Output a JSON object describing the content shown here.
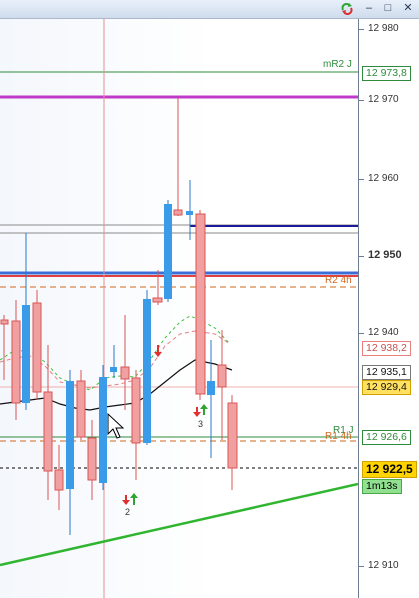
{
  "titlebar": {
    "minimize_glyph": "–",
    "maximize_glyph": "□",
    "close_glyph": "✕",
    "refresh_icon": "refresh-icon"
  },
  "y_axis": {
    "ticks": [
      "12 980",
      "12 970",
      "12 960",
      "12 950",
      "12 940",
      "12 930",
      "12 920",
      "12 910"
    ],
    "major_tick": "12 950"
  },
  "levels": {
    "mr2": {
      "name": "mR2 J",
      "value": "12 973,8",
      "color": "#2e8b3c"
    },
    "r2": {
      "name": "R2 4h",
      "color": "#d2691e"
    },
    "r1j": {
      "name": "R1 J",
      "color": "#2e8b3c"
    },
    "r1_4h": {
      "name": "R1 4h",
      "color": "#d2691e"
    }
  },
  "price_tags": {
    "ma_red": "12 938,2",
    "ma_black": "12 935,1",
    "r1j_value": "12 929,4",
    "r1_4h_value": "12 926,6",
    "last": "12 922,5",
    "timer": "1m13s"
  },
  "markers": {
    "signal_2": "2",
    "signal_3": "3"
  },
  "colors": {
    "bull": "#3a9be8",
    "bear": "#f0a0a0",
    "bear_border": "#d85555",
    "purple": "#c03ac8",
    "navy": "#1a1a9a",
    "trend": "#2fb52f"
  }
}
